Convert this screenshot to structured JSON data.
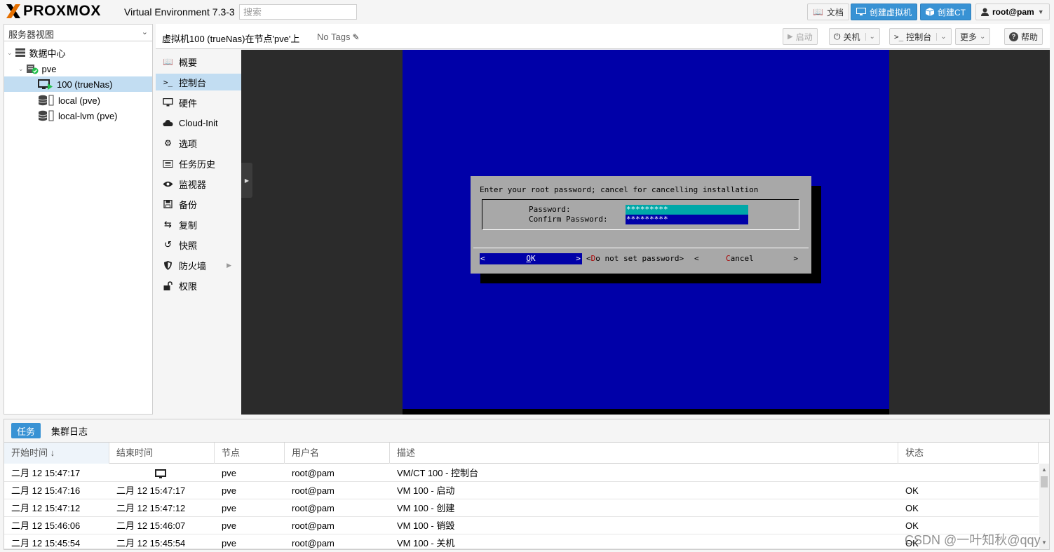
{
  "app": {
    "brand": "PROXMOX",
    "product": "Virtual Environment 7.3-3",
    "search_placeholder": "搜索",
    "accent_color": "#3892d4",
    "logo_orange": "#e57000"
  },
  "toolbar": {
    "docs": "文档",
    "create_vm": "创建虚拟机",
    "create_ct": "创建CT",
    "user": "root@pam"
  },
  "tree": {
    "view_select": "服务器视图",
    "items": [
      {
        "label": "数据中心",
        "icon": "datacenter-icon"
      },
      {
        "label": "pve",
        "icon": "node-online-icon"
      },
      {
        "label": "100 (trueNas)",
        "icon": "vm-running-icon"
      },
      {
        "label": "local (pve)",
        "icon": "storage-icon"
      },
      {
        "label": "local-lvm (pve)",
        "icon": "storage-icon"
      }
    ]
  },
  "header": {
    "title": "虚拟机100 (trueNas)在节点'pve'上",
    "tags": "No Tags",
    "buttons": {
      "start": "启动",
      "shutdown": "关机",
      "console": "控制台",
      "more": "更多",
      "help": "帮助"
    }
  },
  "nav": {
    "items": [
      {
        "label": "概要",
        "icon": "summary-icon"
      },
      {
        "label": "控制台",
        "icon": "console-icon"
      },
      {
        "label": "硬件",
        "icon": "hardware-icon"
      },
      {
        "label": "Cloud-Init",
        "icon": "cloud-icon"
      },
      {
        "label": "选项",
        "icon": "gear-icon"
      },
      {
        "label": "任务历史",
        "icon": "list-icon"
      },
      {
        "label": "监视器",
        "icon": "eye-icon"
      },
      {
        "label": "备份",
        "icon": "floppy-icon"
      },
      {
        "label": "复制",
        "icon": "retweet-icon"
      },
      {
        "label": "快照",
        "icon": "history-icon"
      },
      {
        "label": "防火墙",
        "icon": "shield-icon"
      },
      {
        "label": "权限",
        "icon": "unlock-icon"
      }
    ]
  },
  "console": {
    "prompt": "Enter your root password; cancel for cancelling installation",
    "password_label": "Password:",
    "confirm_label": "Confirm Password:",
    "password_value": "*********",
    "confirm_value": "*********",
    "ok_left": "<",
    "ok_hot": "O",
    "ok_rest": "K",
    "ok_right": ">",
    "nopw_open": "<",
    "nopw_hot": "D",
    "nopw_rest": "o not set password>",
    "cancel_open": "<",
    "cancel_hot": "C",
    "cancel_rest": "ancel",
    "cancel_close": ">",
    "screen_color": "#0000a8"
  },
  "log": {
    "tabs": [
      "任务",
      "集群日志"
    ],
    "columns": [
      "开始时间 ↓",
      "结束时间",
      "节点",
      "用户名",
      "描述",
      "状态"
    ],
    "rows": [
      {
        "start": "二月 12 15:47:17",
        "end": "",
        "end_icon": "monitor-icon",
        "node": "pve",
        "user": "root@pam",
        "desc": "VM/CT 100 - 控制台",
        "status": ""
      },
      {
        "start": "二月 12 15:47:16",
        "end": "二月 12 15:47:17",
        "node": "pve",
        "user": "root@pam",
        "desc": "VM 100 - 启动",
        "status": "OK"
      },
      {
        "start": "二月 12 15:47:12",
        "end": "二月 12 15:47:12",
        "node": "pve",
        "user": "root@pam",
        "desc": "VM 100 - 创建",
        "status": "OK"
      },
      {
        "start": "二月 12 15:46:06",
        "end": "二月 12 15:46:07",
        "node": "pve",
        "user": "root@pam",
        "desc": "VM 100 - 销毁",
        "status": "OK"
      },
      {
        "start": "二月 12 15:45:54",
        "end": "二月 12 15:45:54",
        "node": "pve",
        "user": "root@pam",
        "desc": "VM 100 - 关机",
        "status": "OK"
      }
    ]
  },
  "watermark": "CSDN @一叶知秋@qqy"
}
